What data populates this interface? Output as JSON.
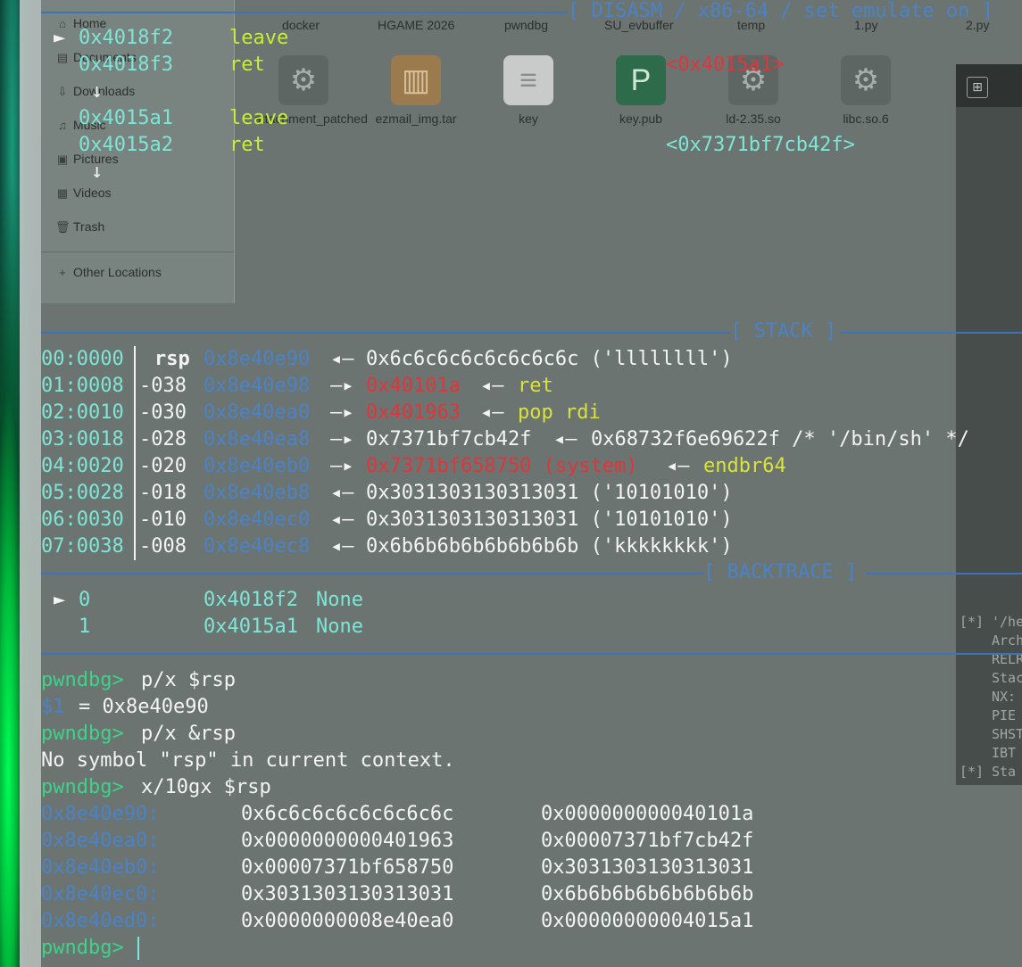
{
  "file_manager": {
    "sidebar": [
      "Home",
      "Documents",
      "Downloads",
      "Music",
      "Pictures",
      "Videos",
      "Trash"
    ],
    "other_locations": "Other Locations",
    "top_row": [
      "docker",
      "HGAME 2026",
      "pwndbg",
      "SU_evbuffer",
      "temp",
      "1.py",
      "2.py"
    ],
    "files": [
      {
        "name": "attachment_patched",
        "icon": "gear-icon"
      },
      {
        "name": "ezmail_img.tar",
        "icon": "archive-icon"
      },
      {
        "name": "key",
        "icon": "document-icon"
      },
      {
        "name": "key.pub",
        "icon": "publisher-icon"
      },
      {
        "name": "ld-2.35.so",
        "icon": "gear-icon"
      },
      {
        "name": "libc.so.6",
        "icon": "gear-icon"
      }
    ]
  },
  "disasm": {
    "header": "[ DISASM / x86-64 / set emulate on ]",
    "lines": [
      {
        "marker": "►",
        "addr": "0x4018f2",
        "op": "leave",
        "arg": ""
      },
      {
        "marker": "",
        "addr": "0x4018f3",
        "op": "ret",
        "arg": "<0x4015a1>"
      },
      {
        "marker": "↓",
        "addr": "",
        "op": "",
        "arg": ""
      },
      {
        "marker": "",
        "addr": "0x4015a1",
        "op": "leave",
        "arg": ""
      },
      {
        "marker": "",
        "addr": "0x4015a2",
        "op": "ret",
        "arg": "<0x7371bf7cb42f>"
      },
      {
        "marker": "↓",
        "addr": "",
        "op": "",
        "arg": ""
      }
    ]
  },
  "stack": {
    "header": "[ STACK ]",
    "rows": [
      {
        "idx": "00:0000",
        "reg": "rsp",
        "addr": "0x8e40e90",
        "arrow": "◂—",
        "val": "0x6c6c6c6c6c6c6c6c ('llllllll')",
        "tail": "",
        "tail2": ""
      },
      {
        "idx": "01:0008",
        "reg": "-038",
        "addr": "0x8e40e98",
        "arrow": "—▸",
        "val": "0x40101a",
        "tail": "◂—",
        "tail2": "ret"
      },
      {
        "idx": "02:0010",
        "reg": "-030",
        "addr": "0x8e40ea0",
        "arrow": "—▸",
        "val": "0x401963",
        "tail": "◂—",
        "tail2": "pop rdi"
      },
      {
        "idx": "03:0018",
        "reg": "-028",
        "addr": "0x8e40ea8",
        "arrow": "—▸",
        "val": "0x7371bf7cb42f",
        "tail": "◂—",
        "tail2": "0x68732f6e69622f /* '/bin/sh' */"
      },
      {
        "idx": "04:0020",
        "reg": "-020",
        "addr": "0x8e40eb0",
        "arrow": "—▸",
        "val": "0x7371bf658750 (system)",
        "tail": "◂—",
        "tail2": "endbr64"
      },
      {
        "idx": "05:0028",
        "reg": "-018",
        "addr": "0x8e40eb8",
        "arrow": "◂—",
        "val": "0x3031303130313031 ('10101010')",
        "tail": "",
        "tail2": ""
      },
      {
        "idx": "06:0030",
        "reg": "-010",
        "addr": "0x8e40ec0",
        "arrow": "◂—",
        "val": "0x3031303130313031 ('10101010')",
        "tail": "",
        "tail2": ""
      },
      {
        "idx": "07:0038",
        "reg": "-008",
        "addr": "0x8e40ec8",
        "arrow": "◂—",
        "val": "0x6b6b6b6b6b6b6b6b ('kkkkkkkk')",
        "tail": "",
        "tail2": ""
      }
    ]
  },
  "backtrace": {
    "header": "[ BACKTRACE ]",
    "frames": [
      {
        "marker": "►",
        "num": "0",
        "addr": "0x4018f2",
        "sym": "None"
      },
      {
        "marker": "",
        "num": "1",
        "addr": "0x4015a1",
        "sym": "None"
      }
    ]
  },
  "console": {
    "prompt": "pwndbg>",
    "cmd1": "p/x $rsp",
    "res1_var": "$1",
    "res1_val": "= 0x8e40e90",
    "cmd2": "p/x &rsp",
    "err2": "No symbol \"rsp\" in current context.",
    "cmd3": "x/10gx $rsp",
    "mem": [
      {
        "addr": "0x8e40e90:",
        "a": "0x6c6c6c6c6c6c6c6c",
        "b": "0x000000000040101a"
      },
      {
        "addr": "0x8e40ea0:",
        "a": "0x0000000000401963",
        "b": "0x00007371bf7cb42f"
      },
      {
        "addr": "0x8e40eb0:",
        "a": "0x00007371bf658750",
        "b": "0x3031303130313031"
      },
      {
        "addr": "0x8e40ec0:",
        "a": "0x3031303130313031",
        "b": "0x6b6b6b6b6b6b6b6b"
      },
      {
        "addr": "0x8e40ed0:",
        "a": "0x0000000008e40ea0",
        "b": "0x00000000004015a1"
      }
    ]
  },
  "side_panel": {
    "tag1": "[*]",
    "path": "'/he",
    "lines": [
      "Arch",
      "RELR",
      "Stac",
      "NX:",
      "PIE",
      "SHST",
      "IBT"
    ],
    "tag2": "[*]",
    "last": "Sta"
  },
  "colors": {
    "instruction": "#c9ee3a",
    "address": "#7ee6d7",
    "stack_addr": "#4b83c6",
    "code_ptr": "#e0353a",
    "prompt": "#3fd28a",
    "rule": "#3d74b8"
  }
}
